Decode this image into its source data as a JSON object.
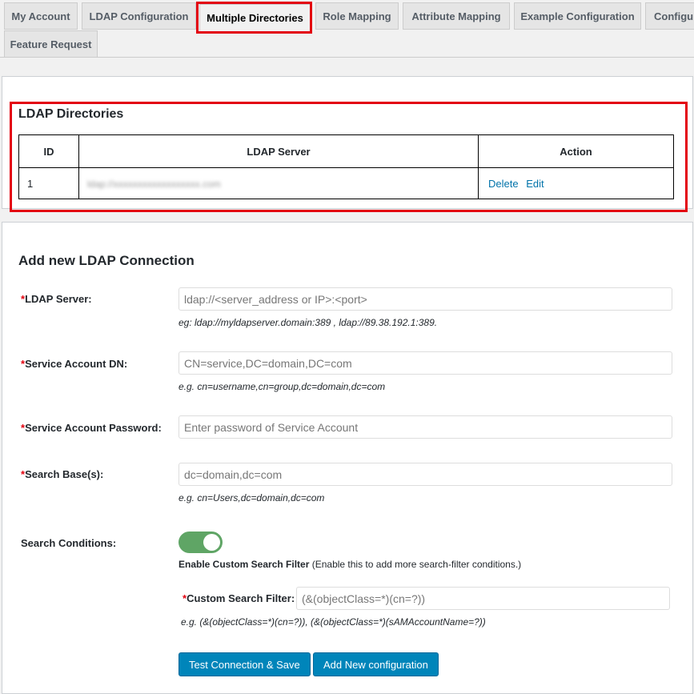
{
  "tabs": [
    {
      "label": "My Account"
    },
    {
      "label": "LDAP Configuration"
    },
    {
      "label": "Multiple Directories"
    },
    {
      "label": "Role Mapping"
    },
    {
      "label": "Attribute Mapping"
    },
    {
      "label": "Example Configuration"
    },
    {
      "label": "Configur"
    },
    {
      "label": "Feature Request"
    }
  ],
  "directories": {
    "title": "LDAP Directories",
    "columns": [
      "ID",
      "LDAP Server",
      "Action"
    ],
    "rows": [
      {
        "id": "1",
        "server": "ldap://xxxxxxxxxxxxxxxxxx.com",
        "delete_label": "Delete",
        "edit_label": "Edit"
      }
    ]
  },
  "form": {
    "title": "Add new LDAP Connection",
    "required_mark": "*",
    "ldap_server": {
      "label": "LDAP Server:",
      "placeholder": "ldap://<server_address or IP>:<port>",
      "hint": "eg: ldap://myldapserver.domain:389 , ldap://89.38.192.1:389."
    },
    "service_dn": {
      "label": "Service Account DN:",
      "placeholder": "CN=service,DC=domain,DC=com",
      "hint": "e.g. cn=username,cn=group,dc=domain,dc=com"
    },
    "service_password": {
      "label": "Service Account Password:",
      "placeholder": "Enter password of Service Account"
    },
    "search_base": {
      "label": "Search Base(s):",
      "placeholder": "dc=domain,dc=com",
      "hint": "e.g. cn=Users,dc=domain,dc=com"
    },
    "search_conditions": {
      "label": "Search Conditions:",
      "enabled": true,
      "caption_bold": "Enable Custom Search Filter",
      "caption_rest": " (Enable this to add more search-filter conditions.)"
    },
    "custom_filter": {
      "label": "Custom Search Filter:",
      "placeholder": "(&(objectClass=*)(cn=?))",
      "hint": "e.g. (&(objectClass=*)(cn=?)), (&(objectClass=*)(sAMAccountName=?))"
    },
    "test_save_label": "Test Connection & Save",
    "add_config_label": "Add New configuration"
  },
  "colors": {
    "highlight": "#e3000f",
    "link": "#0073aa",
    "primary_button": "#0085ba",
    "toggle_on": "#5fa565"
  }
}
